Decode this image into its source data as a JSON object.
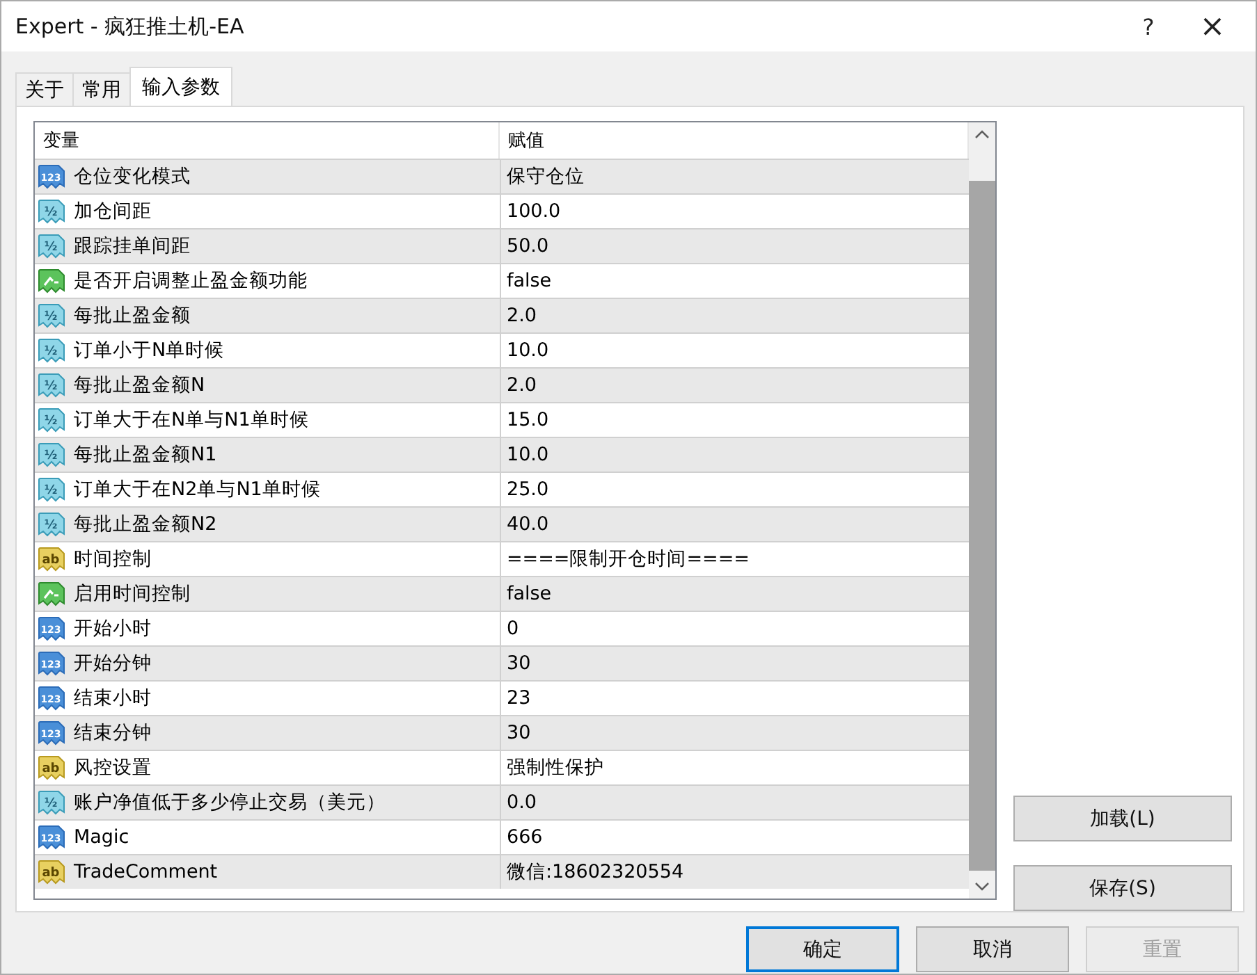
{
  "window": {
    "title": "Expert - 疯狂推土机-EA",
    "help": "?",
    "close": "×"
  },
  "tabs": [
    {
      "label": "关于",
      "selected": false
    },
    {
      "label": "常用",
      "selected": false
    },
    {
      "label": "输入参数",
      "selected": true
    }
  ],
  "table": {
    "columns": [
      "变量",
      "赋值"
    ],
    "rows": [
      {
        "kind": "int",
        "icon_text": "123",
        "name": "仓位变化模式",
        "value": "保守仓位"
      },
      {
        "kind": "double",
        "icon_text": "½",
        "name": "加仓间距",
        "value": "100.0"
      },
      {
        "kind": "double",
        "icon_text": "½",
        "name": "跟踪挂单间距",
        "value": "50.0"
      },
      {
        "kind": "bool",
        "name": "是否开启调整止盈金额功能",
        "value": "false"
      },
      {
        "kind": "double",
        "icon_text": "½",
        "name": "每批止盈金额",
        "value": "2.0"
      },
      {
        "kind": "double",
        "icon_text": "½",
        "name": "订单小于N单时候",
        "value": "10.0"
      },
      {
        "kind": "double",
        "icon_text": "½",
        "name": "每批止盈金额N",
        "value": "2.0"
      },
      {
        "kind": "double",
        "icon_text": "½",
        "name": "订单大于在N单与N1单时候",
        "value": "15.0"
      },
      {
        "kind": "double",
        "icon_text": "½",
        "name": "每批止盈金额N1",
        "value": "10.0"
      },
      {
        "kind": "double",
        "icon_text": "½",
        "name": "订单大于在N2单与N1单时候",
        "value": "25.0"
      },
      {
        "kind": "double",
        "icon_text": "½",
        "name": "每批止盈金额N2",
        "value": "40.0"
      },
      {
        "kind": "string",
        "icon_text": "ab",
        "name": "时间控制",
        "value": "====限制开仓时间===="
      },
      {
        "kind": "bool",
        "name": "启用时间控制",
        "value": "false"
      },
      {
        "kind": "int",
        "icon_text": "123",
        "name": "开始小时",
        "value": "0"
      },
      {
        "kind": "int",
        "icon_text": "123",
        "name": "开始分钟",
        "value": "30"
      },
      {
        "kind": "int",
        "icon_text": "123",
        "name": "结束小时",
        "value": "23"
      },
      {
        "kind": "int",
        "icon_text": "123",
        "name": "结束分钟",
        "value": "30"
      },
      {
        "kind": "string",
        "icon_text": "ab",
        "name": "风控设置",
        "value": "强制性保护"
      },
      {
        "kind": "double",
        "icon_text": "½",
        "name": "账户净值低于多少停止交易（美元）",
        "value": "0.0"
      },
      {
        "kind": "int",
        "icon_text": "123",
        "name": "Magic",
        "value": "666"
      },
      {
        "kind": "string",
        "icon_text": "ab",
        "name": "TradeComment",
        "value": "微信:18602320554"
      }
    ]
  },
  "side_buttons": [
    "加载(L)",
    "保存(S)"
  ],
  "buttons": [
    {
      "label": "确定",
      "default": true,
      "disabled": false
    },
    {
      "label": "取消",
      "default": false,
      "disabled": false
    },
    {
      "label": "重置",
      "default": false,
      "disabled": true
    }
  ]
}
